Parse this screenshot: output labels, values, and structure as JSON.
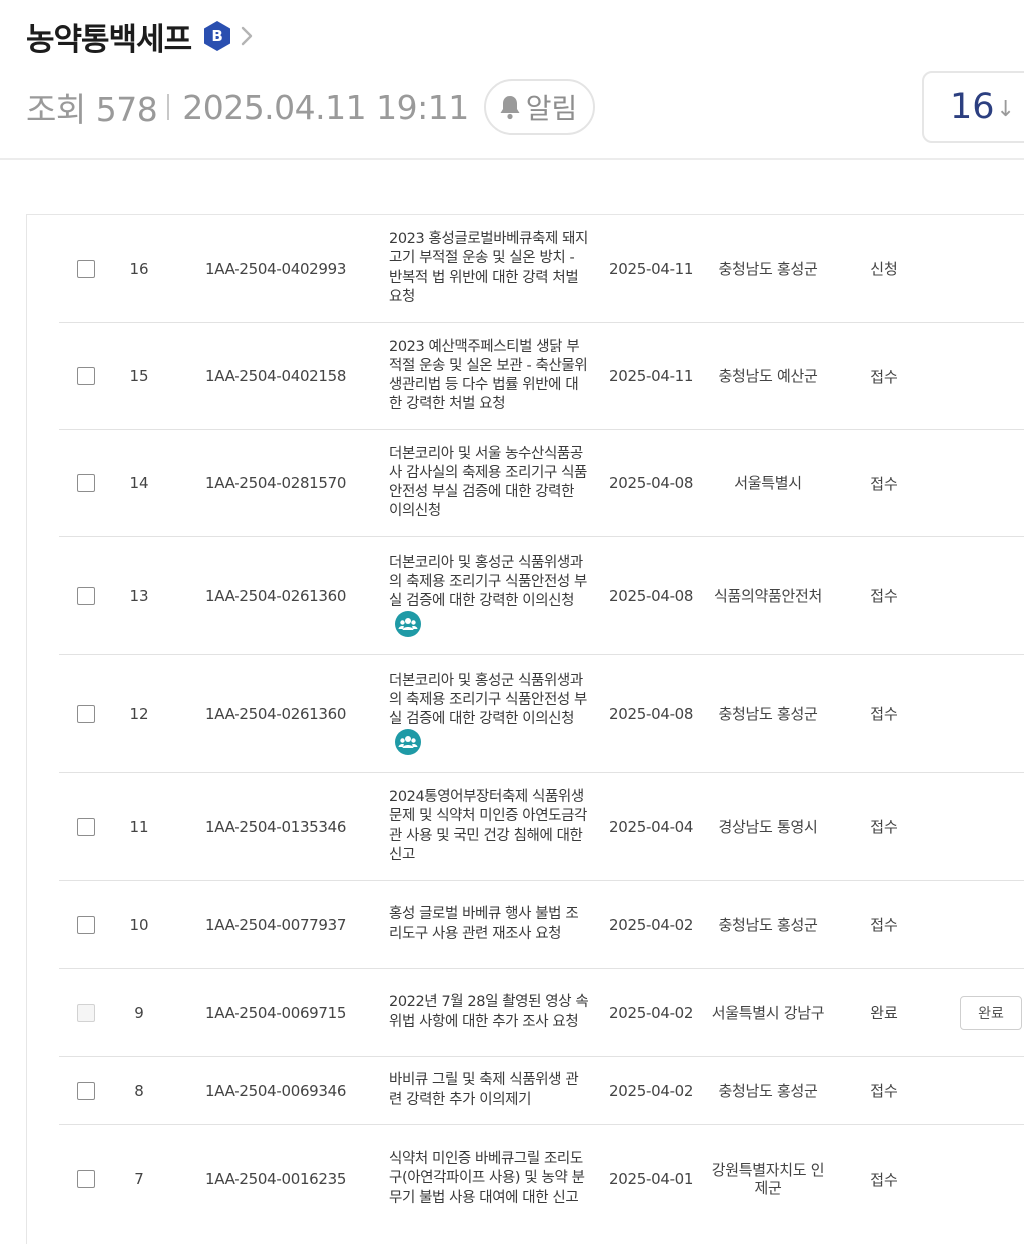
{
  "header": {
    "author_name": "농약통백세프",
    "badge_letter": "B",
    "views": "조회 578",
    "date": "2025.04.11 19:11",
    "alarm_label": "알림",
    "like_count": "16",
    "like_arrow": "↓"
  },
  "rows": [
    {
      "no": "16",
      "id": "1AA-2504-0402993",
      "title": "2023 홍성글로벌바베큐축제 돼지고기 부적절 운송 및 실온 방치 - 반복적 법 위반에 대한 강력 처벌 요청",
      "date": "2025-04-11",
      "org": "충청남도 홍성군",
      "status": "신청"
    },
    {
      "no": "15",
      "id": "1AA-2504-0402158",
      "title": "2023 예산맥주페스티벌 생닭 부적절 운송 및 실온 보관 - 축산물위생관리법 등 다수 법률 위반에 대한 강력한 처벌 요청",
      "date": "2025-04-11",
      "org": "충청남도 예산군",
      "status": "접수"
    },
    {
      "no": "14",
      "id": "1AA-2504-0281570",
      "title": "더본코리아 및 서울 농수산식품공사 감사실의 축제용 조리기구 식품안전성 부실 검증에 대한 강력한 이의신청",
      "date": "2025-04-08",
      "org": "서울특별시",
      "status": "접수"
    },
    {
      "no": "13",
      "id": "1AA-2504-0261360",
      "title": "더본코리아 및 홍성군 식품위생과의 축제용 조리기구 식품안전성 부실 검증에 대한 강력한 이의신청",
      "date": "2025-04-08",
      "org": "식품의약품안전처",
      "status": "접수",
      "group_icon": "people-icon"
    },
    {
      "no": "12",
      "id": "1AA-2504-0261360",
      "title": "더본코리아 및 홍성군 식품위생과의 축제용 조리기구 식품안전성 부실 검증에 대한 강력한 이의신청",
      "date": "2025-04-08",
      "org": "충청남도 홍성군",
      "status": "접수",
      "group_icon": "people-icon"
    },
    {
      "no": "11",
      "id": "1AA-2504-0135346",
      "title": "2024통영어부장터축제 식품위생 문제 및 식약처 미인증 아연도금각관 사용 및 국민 건강 침해에 대한 신고",
      "date": "2025-04-04",
      "org": "경상남도 통영시",
      "status": "접수"
    },
    {
      "no": "10",
      "id": "1AA-2504-0077937",
      "title": "홍성 글로벌 바베큐 행사 불법 조리도구 사용 관련 재조사 요청",
      "date": "2025-04-02",
      "org": "충청남도 홍성군",
      "status": "접수"
    },
    {
      "no": "9",
      "id": "1AA-2504-0069715",
      "title": "2022년 7월 28일 촬영된 영상 속 위법 사항에 대한 추가 조사 요청",
      "date": "2025-04-02",
      "org": "서울특별시 강남구",
      "status": "완료",
      "action_label": "완료",
      "disabled": true
    },
    {
      "no": "8",
      "id": "1AA-2504-0069346",
      "title": "바비큐 그릴 및 축제 식품위생 관련 강력한 추가 이의제기",
      "date": "2025-04-02",
      "org": "충청남도 홍성군",
      "status": "접수"
    },
    {
      "no": "7",
      "id": "1AA-2504-0016235",
      "title": "식약처 미인증 바베큐그릴 조리도구(아연각파이프 사용) 및 농약 분무기 불법 사용 대여에 대한 신고",
      "date": "2025-04-01",
      "org": "강원특별자치도 인제군",
      "status": "접수"
    }
  ],
  "colors": {
    "badge": "#2a4fb0",
    "people_icon": "#1f9aa6",
    "like_count": "#2c3f80",
    "meta_text": "#9a9a9a"
  }
}
